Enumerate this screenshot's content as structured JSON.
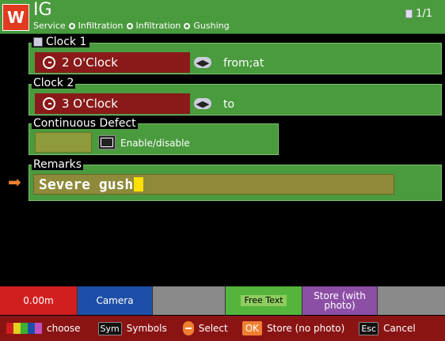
{
  "header": {
    "logo": "W",
    "title": "IG",
    "breadcrumbs": [
      "Service",
      "Infiltration",
      "Infiltration",
      "Gushing"
    ],
    "page": "1/1"
  },
  "form": {
    "clock1": {
      "label": "Clock 1",
      "value": "2 O'Clock",
      "relation": "from;at"
    },
    "clock2": {
      "label": "Clock 2",
      "value": "3 O'Clock",
      "relation": "to"
    },
    "continuous": {
      "label": "Continuous Defect",
      "value": "",
      "action": "Enable/disable"
    },
    "remarks": {
      "label": "Remarks",
      "value": "Severe gush"
    }
  },
  "function_keys": [
    {
      "label": "0.00m",
      "color": "#d11f1f"
    },
    {
      "label": "Camera",
      "color": "#1e4fa8"
    },
    {
      "label": "",
      "color": "#8a8a8a"
    },
    {
      "label": "Free Text",
      "color": "#55b43c"
    },
    {
      "label": "Store (with photo)",
      "color": "#8d4fa6"
    },
    {
      "label": "",
      "color": "#8a8a8a"
    }
  ],
  "footer": {
    "choose_label": "choose",
    "sym_key": "Sym",
    "symbols_label": "Symbols",
    "select_label": "Select",
    "ok_key": "OK",
    "store_label": "Store (no photo)",
    "esc_key": "Esc",
    "cancel_label": "Cancel",
    "color_keys": [
      "#d11f1f",
      "#e0d020",
      "#3cb030",
      "#1e4fa8",
      "#c050c0"
    ]
  },
  "colors": {
    "header_green": "#4a9a3e",
    "clock_red": "#8a1a1a",
    "footer_red": "#8a1414",
    "cursor_yellow": "#ffe000",
    "focus_arrow": "#f08030"
  }
}
